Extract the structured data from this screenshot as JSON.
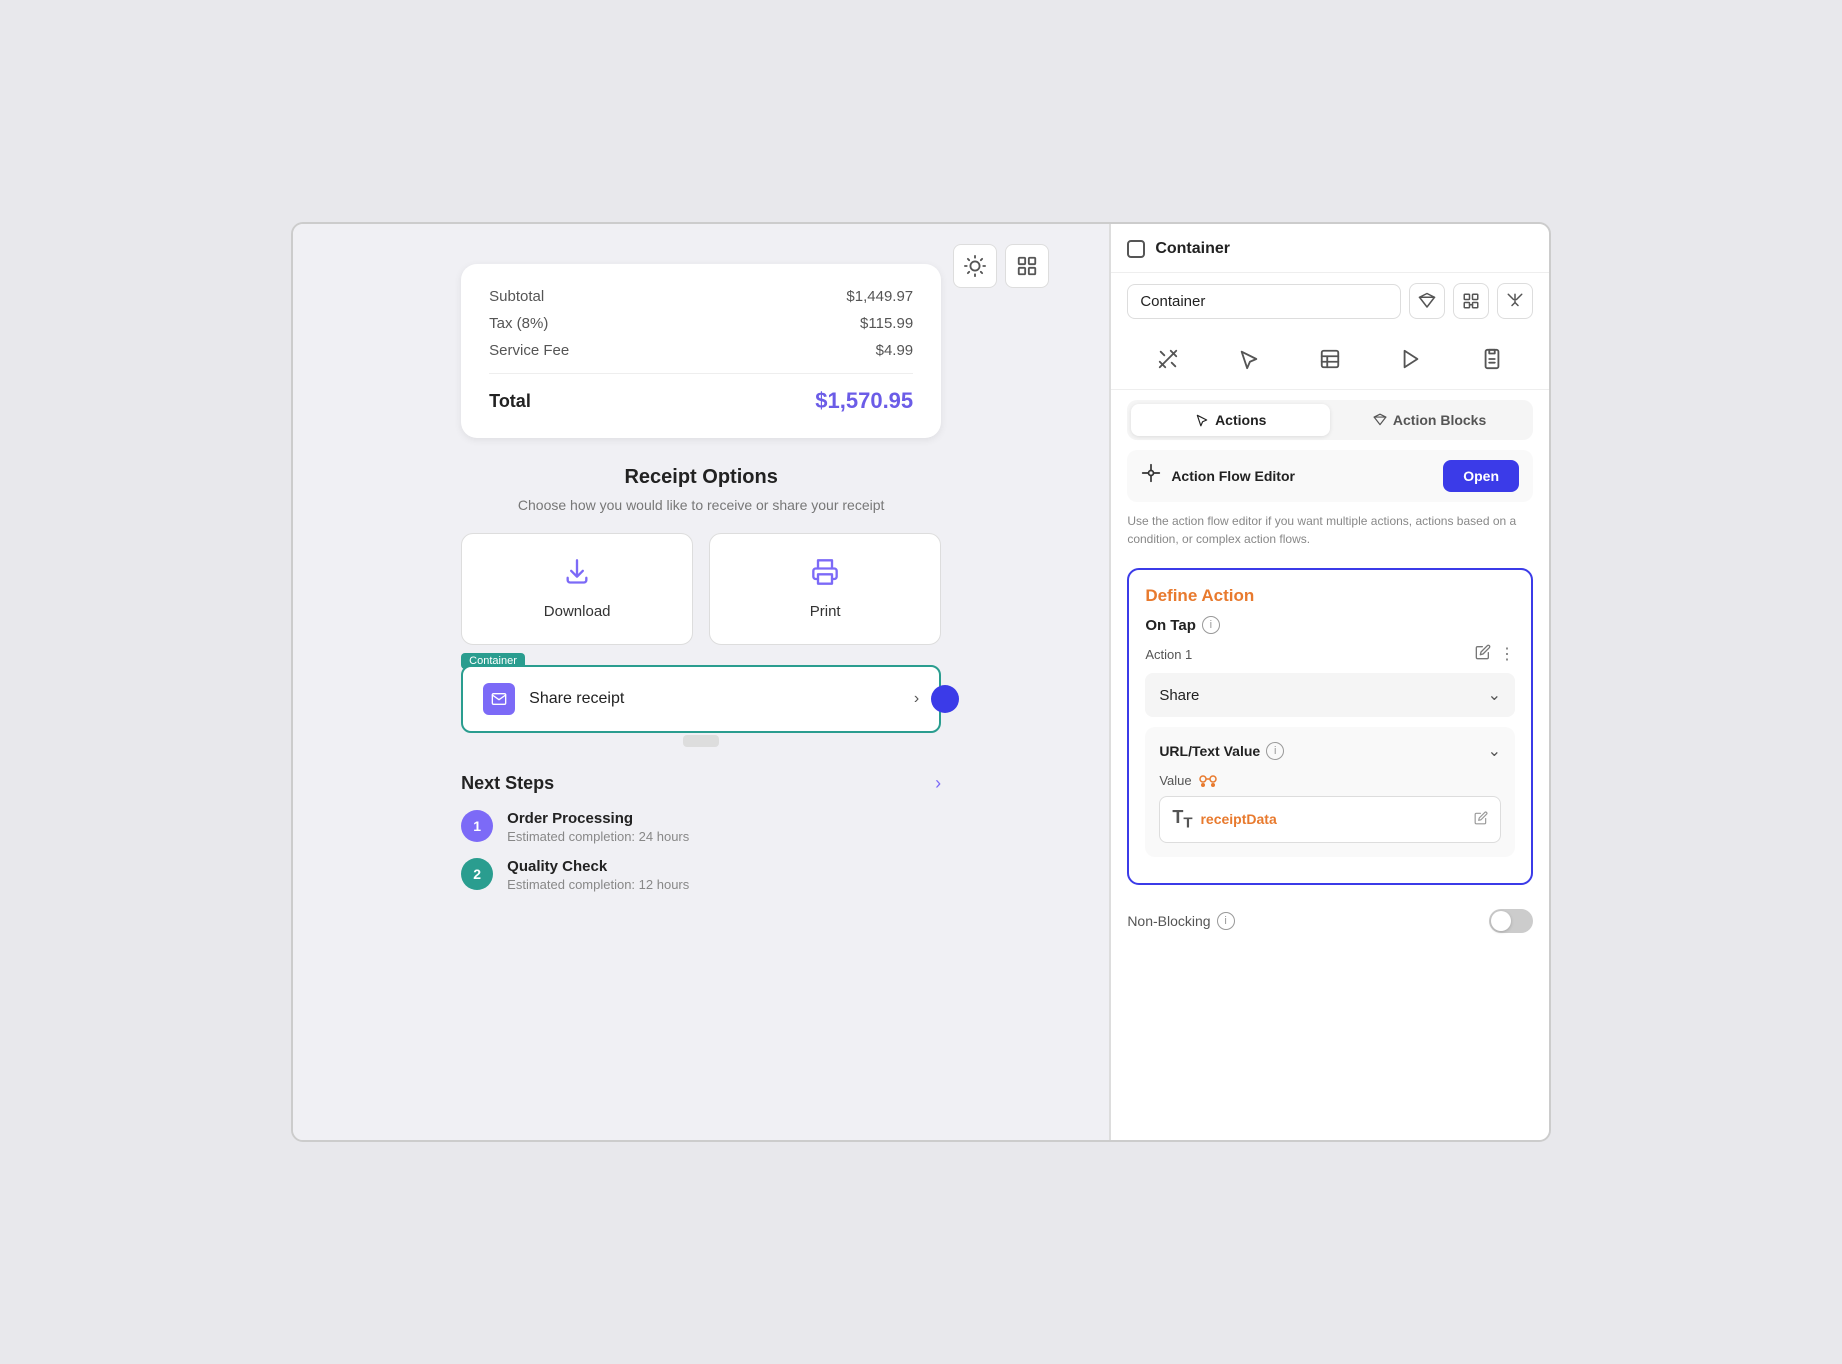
{
  "toolbar": {
    "sun_btn": "☀",
    "diagram_btn": "⊞"
  },
  "receipt": {
    "subtotal_label": "Subtotal",
    "subtotal_value": "$1,449.97",
    "tax_label": "Tax (8%)",
    "tax_value": "$115.99",
    "service_label": "Service Fee",
    "service_value": "$4.99",
    "total_label": "Total",
    "total_value": "$1,570.95"
  },
  "receipt_options": {
    "title": "Receipt Options",
    "description": "Choose how you would like to receive or share your receipt",
    "download_label": "Download",
    "print_label": "Print"
  },
  "container_tag": "Container",
  "share_receipt": {
    "text": "Share receipt"
  },
  "next_steps": {
    "title": "Next Steps",
    "steps": [
      {
        "num": "1",
        "color": "purple",
        "title": "Order Processing",
        "desc": "Estimated completion: 24 hours"
      },
      {
        "num": "2",
        "color": "green",
        "title": "Quality Check",
        "desc": "Estimated completion: 12 hours"
      }
    ]
  },
  "right_panel": {
    "header_title": "Container",
    "name_input_value": "Container",
    "icon_btn1": "✦",
    "icon_btn2": "⊕",
    "icon_btn3": "⊗",
    "tool_icons": [
      "✕",
      "⇱",
      "▦",
      "▶",
      "📋"
    ],
    "actions_tab": "Actions",
    "action_blocks_tab": "Action Blocks",
    "action_flow_label": "Action Flow Editor",
    "open_btn_label": "Open",
    "action_flow_desc": "Use the action flow editor if you want multiple actions, actions based on a condition, or complex action flows.",
    "define_action_title": "Define Action",
    "on_tap_label": "On Tap",
    "action1_label": "Action 1",
    "share_label": "Share",
    "url_text_label": "URL/Text Value",
    "value_label": "Value",
    "receipt_data": "receiptData",
    "non_blocking_label": "Non-Blocking"
  }
}
